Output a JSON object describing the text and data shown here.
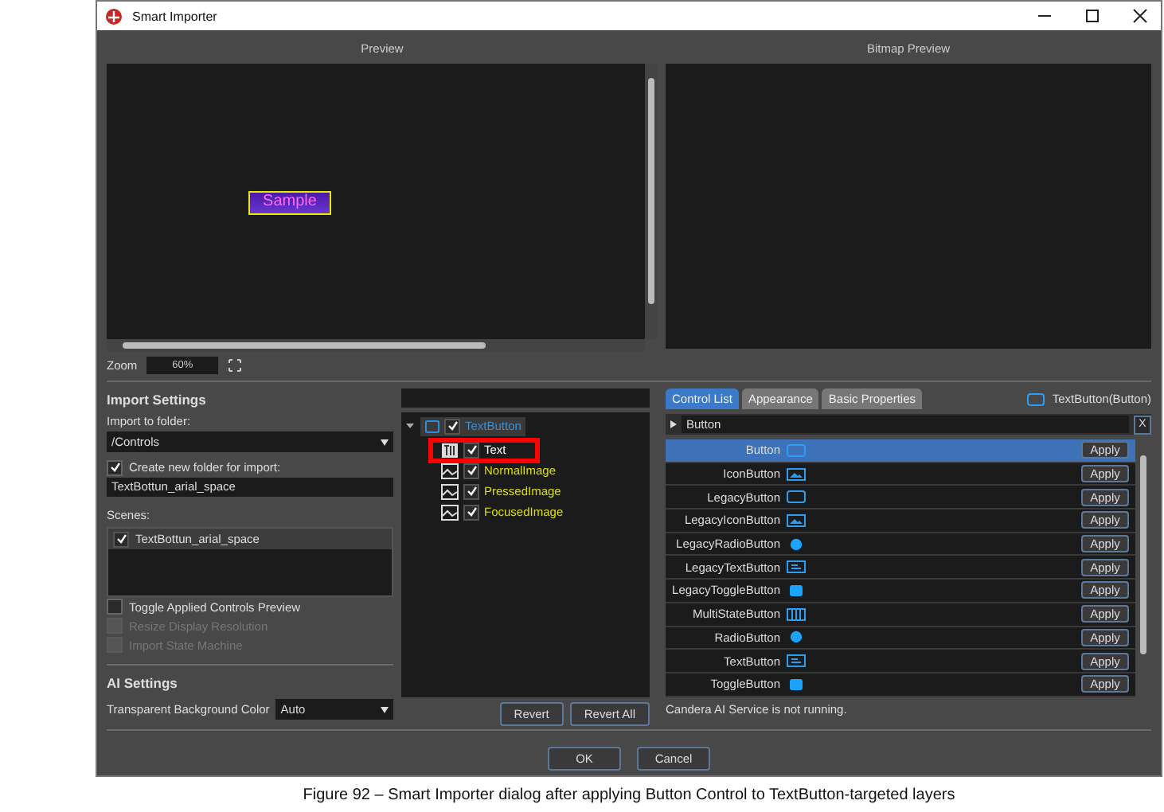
{
  "window": {
    "title": "Smart Importer"
  },
  "preview": {
    "title": "Preview",
    "sample_text": "Sample"
  },
  "bitmap_preview": {
    "title": "Bitmap Preview"
  },
  "zoom": {
    "label": "Zoom",
    "value": "60%"
  },
  "import_settings": {
    "title": "Import Settings",
    "folder_label": "Import to folder:",
    "folder": "/Controls",
    "create_folder": {
      "label": "Create new folder for import:",
      "checked": true
    },
    "folder_name": "TextBottun_arial_space",
    "scenes_label": "Scenes:",
    "scenes": [
      {
        "label": "TextBottun_arial_space",
        "checked": true,
        "selected": true
      }
    ],
    "options": [
      {
        "label": "Toggle Applied Controls Preview",
        "checked": false,
        "disabled": false
      },
      {
        "label": "Resize Display Resolution",
        "checked": false,
        "disabled": true
      },
      {
        "label": "Import State Machine",
        "checked": false,
        "disabled": true
      }
    ]
  },
  "ai_settings": {
    "title": "AI Settings",
    "background_label": "Transparent Background Color",
    "background_value": "Auto"
  },
  "layer_tree": {
    "root": {
      "label": "TextButton",
      "checked": true,
      "expanded": true,
      "children": [
        {
          "label": "Text",
          "kind": "text",
          "checked": true,
          "highlighted": true
        },
        {
          "label": "NormalImage",
          "kind": "image",
          "checked": true,
          "highlighted": false
        },
        {
          "label": "PressedImage",
          "kind": "image",
          "checked": true,
          "highlighted": false
        },
        {
          "label": "FocusedImage",
          "kind": "image",
          "checked": true,
          "highlighted": false
        }
      ]
    },
    "buttons": [
      "Revert",
      "Revert All"
    ]
  },
  "tabs": [
    {
      "label": "Control List",
      "selected": true
    },
    {
      "label": "Appearance",
      "selected": false
    },
    {
      "label": "Basic Properties",
      "selected": false
    }
  ],
  "current_control": "TextButton(Button)",
  "filter": {
    "value": "Button",
    "clear": "X"
  },
  "controls": [
    {
      "name": "Button",
      "kind": "frame",
      "selected": true,
      "action": "Apply"
    },
    {
      "name": "IconButton",
      "kind": "image",
      "selected": false,
      "action": "Apply"
    },
    {
      "name": "LegacyButton",
      "kind": "frame",
      "selected": false,
      "action": "Apply"
    },
    {
      "name": "LegacyIconButton",
      "kind": "image",
      "selected": false,
      "action": "Apply"
    },
    {
      "name": "LegacyRadioButton",
      "kind": "radio",
      "selected": false,
      "action": "Apply"
    },
    {
      "name": "LegacyTextButton",
      "kind": "text",
      "selected": false,
      "action": "Apply"
    },
    {
      "name": "LegacyToggleButton",
      "kind": "toggle",
      "selected": false,
      "action": "Apply"
    },
    {
      "name": "MultiStateButton",
      "kind": "multistate",
      "selected": false,
      "action": "Apply"
    },
    {
      "name": "RadioButton",
      "kind": "radio",
      "selected": false,
      "action": "Apply"
    },
    {
      "name": "TextButton",
      "kind": "text",
      "selected": false,
      "action": "Apply"
    },
    {
      "name": "ToggleButton",
      "kind": "toggle",
      "selected": false,
      "action": "Apply"
    }
  ],
  "status": "Candera AI Service is not running.",
  "dialog_buttons": [
    "OK",
    "Cancel"
  ],
  "caption": "Figure 92 – Smart Importer dialog after applying Button Control to TextButton-targeted layers"
}
